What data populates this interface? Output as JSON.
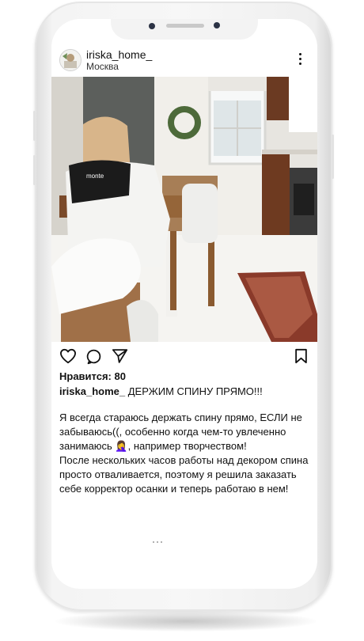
{
  "post": {
    "username": "iriska_home_",
    "location": "Москва",
    "likes_text": "Нравится: 80",
    "caption_user": "iriska_home_",
    "caption_title": " ДЕРЖИМ СПИНУ ПРЯМО!!!",
    "body": "Я всегда стараюсь держать спину прямо, ЕСЛИ не забываюсь((, особенно когда чем-то увлеченно занимаюсь 🤦‍♀️, например творчеством!\nПосле нескольких часов работы над декором спина просто отваливается, поэтому я решила заказать себе корректор осанки и теперь работаю в нем!",
    "image_caption_text": "monte"
  },
  "icons": {
    "like": "heart-icon",
    "comment": "comment-icon",
    "share": "send-icon",
    "save": "bookmark-icon",
    "more": "more-vertical-icon"
  },
  "colors": {
    "phone_frame": "#f4f4f4",
    "text": "#111111",
    "camera": "#2c3345"
  }
}
